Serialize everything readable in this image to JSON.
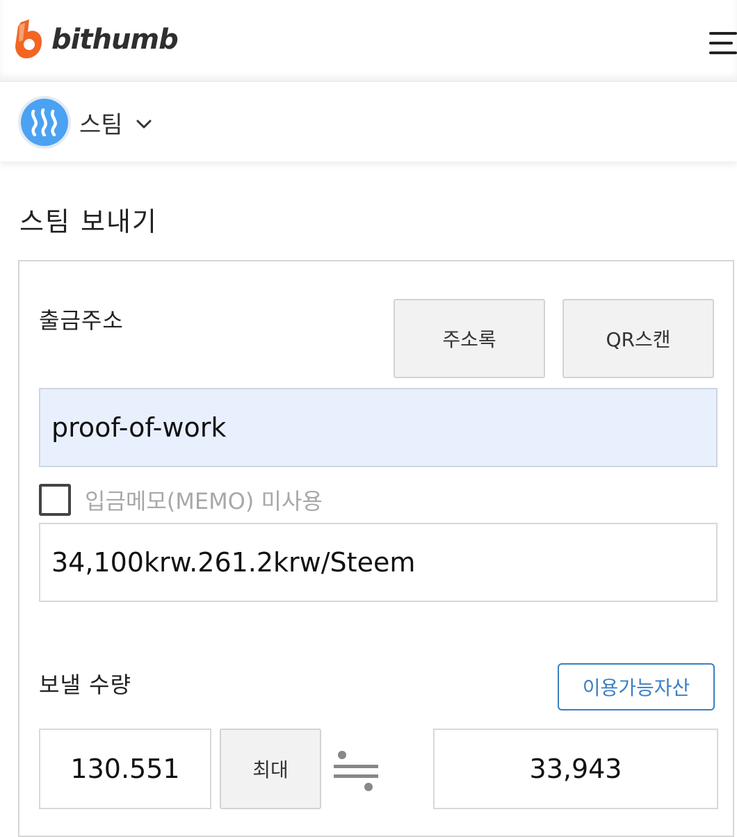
{
  "header": {
    "brand": "bithumb",
    "brand_color": "#f26522",
    "menu_icon": "hamburger-menu-icon"
  },
  "coin": {
    "name": "스팀",
    "icon": "steem-coin-icon",
    "icon_color": "#4ba2f2"
  },
  "page": {
    "title": "스팀 보내기"
  },
  "address": {
    "label": "출금주소",
    "address_book_label": "주소록",
    "qr_scan_label": "QR스캔",
    "value": "proof-of-work"
  },
  "memo": {
    "checkbox_label": "입금메모(MEMO) 미사용",
    "checked": false,
    "value": "34,100krw.261.2krw/Steem"
  },
  "amount": {
    "label": "보낼 수량",
    "available_assets_label": "이용가능자산",
    "value": "130.551",
    "max_label": "최대",
    "converted_value": "33,943",
    "approx_icon": "approximately-equal-icon"
  }
}
